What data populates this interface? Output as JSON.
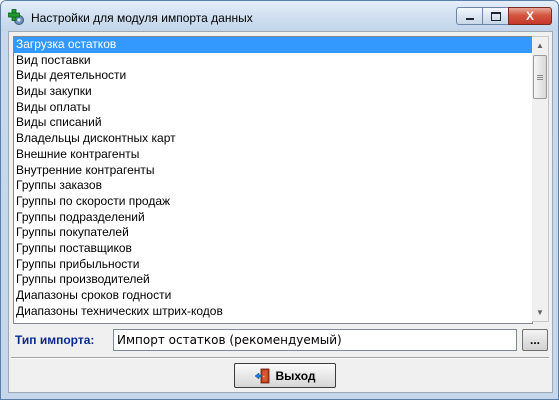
{
  "window": {
    "title": "Настройки для модуля импорта данных",
    "close_label": "X"
  },
  "list": {
    "selected_index": 0,
    "items": [
      "Загрузка остатков",
      "Вид поставки",
      "Виды деятельности",
      "Виды закупки",
      "Виды оплаты",
      "Виды списаний",
      "Владельцы дисконтных карт",
      "Внешние контрагенты",
      "Внутренние контрагенты",
      "Группы заказов",
      "Группы по скорости продаж",
      "Группы подразделений",
      "Группы покупателей",
      "Группы поставщиков",
      "Группы прибыльности",
      "Группы производителей",
      "Диапазоны сроков годности",
      "Диапазоны технических штрих-кодов"
    ]
  },
  "import": {
    "label": "Тип импорта:",
    "value": "Импорт остатков (рекомендуемый)",
    "browse_label": "..."
  },
  "footer": {
    "exit_label": "Выход"
  },
  "colors": {
    "selection": "#3399ff",
    "label_blue": "#0a2a8a",
    "close_red": "#c5392a"
  },
  "icons": {
    "app": "green-cross-gear-icon",
    "exit": "door-exit-icon"
  }
}
